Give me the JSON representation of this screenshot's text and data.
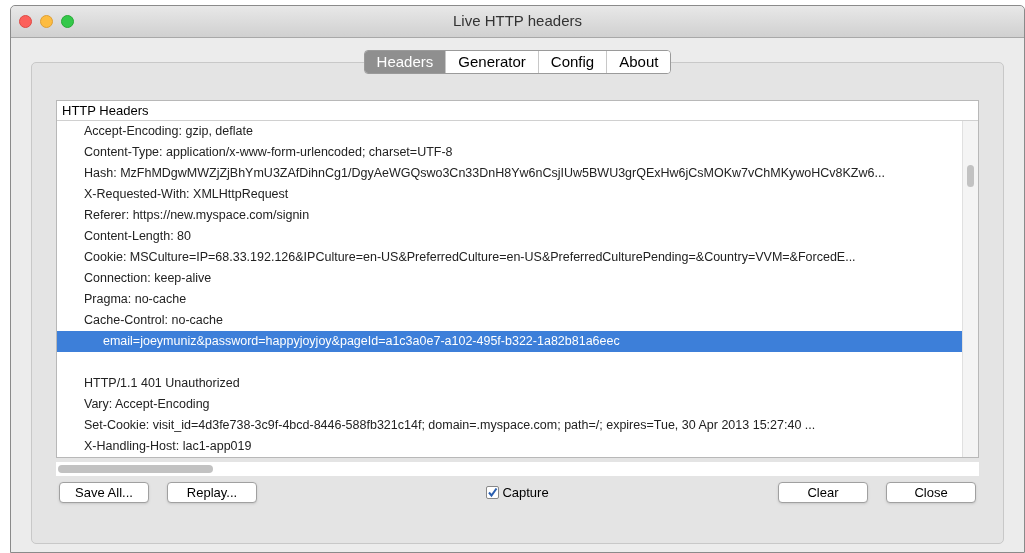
{
  "window": {
    "title": "Live HTTP headers"
  },
  "tabs": [
    {
      "label": "Headers",
      "selected": true
    },
    {
      "label": "Generator",
      "selected": false
    },
    {
      "label": "Config",
      "selected": false
    },
    {
      "label": "About",
      "selected": false
    }
  ],
  "list": {
    "heading": "HTTP Headers",
    "rows": [
      {
        "kind": "header",
        "text": "Accept-Encoding: gzip, deflate",
        "selected": false
      },
      {
        "kind": "header",
        "text": "Content-Type: application/x-www-form-urlencoded; charset=UTF-8",
        "selected": false
      },
      {
        "kind": "header",
        "text": "Hash: MzFhMDgwMWZjZjBhYmU3ZAfDihnCg1/DgyAeWGQswo3Cn33DnH8Yw6nCsjIUw5BWU3grQExHw6jCsMOKw7vChMKywoHCv8KZw6...",
        "selected": false
      },
      {
        "kind": "header",
        "text": "X-Requested-With: XMLHttpRequest",
        "selected": false
      },
      {
        "kind": "header",
        "text": "Referer: https://new.myspace.com/signin",
        "selected": false
      },
      {
        "kind": "header",
        "text": "Content-Length: 80",
        "selected": false
      },
      {
        "kind": "header",
        "text": "Cookie: MSCulture=IP=68.33.192.126&IPCulture=en-US&PreferredCulture=en-US&PreferredCulturePending=&Country=VVM=&ForcedE...",
        "selected": false
      },
      {
        "kind": "header",
        "text": "Connection: keep-alive",
        "selected": false
      },
      {
        "kind": "header",
        "text": "Pragma: no-cache",
        "selected": false
      },
      {
        "kind": "header",
        "text": "Cache-Control: no-cache",
        "selected": false
      },
      {
        "kind": "body",
        "text": "email=joeymuniz&password=happyjoyjoy&pageId=a1c3a0e7-a102-495f-b322-1a82b81a6eec",
        "selected": true
      },
      {
        "kind": "status",
        "text": "HTTP/1.1 401 Unauthorized",
        "selected": false
      },
      {
        "kind": "header",
        "text": "Vary: Accept-Encoding",
        "selected": false
      },
      {
        "kind": "header",
        "text": "Set-Cookie: visit_id=4d3fe738-3c9f-4bcd-8446-588fb321c14f; domain=.myspace.com; path=/; expires=Tue, 30 Apr 2013 15:27:40 ...",
        "selected": false
      },
      {
        "kind": "header",
        "text": "X-Handling-Host: lac1-app019",
        "selected": false
      }
    ]
  },
  "buttons_left": [
    "Save All...",
    "Replay..."
  ],
  "capture": {
    "label": "Capture",
    "checked": true
  },
  "buttons_right": [
    "Clear",
    "Close"
  ]
}
